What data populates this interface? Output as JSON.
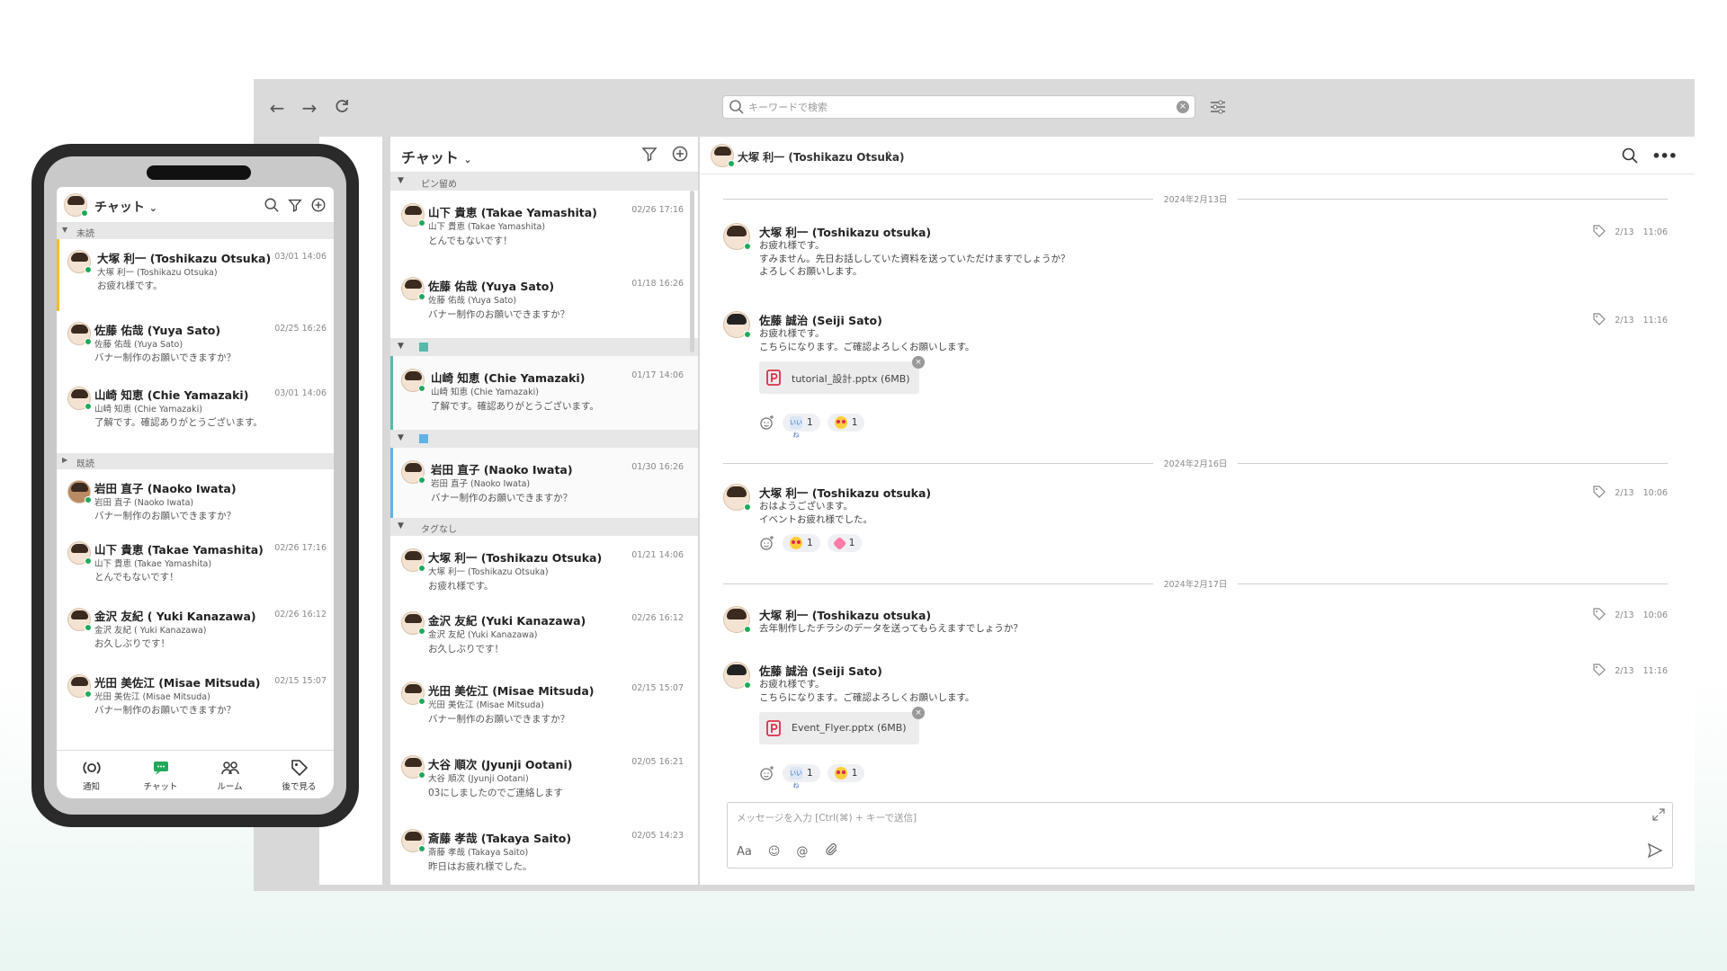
{
  "search": {
    "placeholder": "キーワードで検索"
  },
  "list": {
    "title": "チャット ",
    "groups": [
      {
        "label": "ピン留め",
        "items": [
          {
            "name": "山下 貴恵 (Takae Yamashita)",
            "sub": "山下 貴恵 (Takae Yamashita)",
            "msg": "とんでもないです！",
            "time": "02/26 17:16"
          },
          {
            "name": "佐藤 佑哉 (Yuya Sato)",
            "sub": "佐藤 佑哉 (Yuya Sato)",
            "msg": "バナー制作のお願いできますか？",
            "time": "01/18 16:26"
          }
        ]
      },
      {
        "label": "",
        "items": [
          {
            "name": "山崎 知恵 (Chie Yamazaki)",
            "sub": "山崎 知恵 (Chie Yamazaki)",
            "msg": "了解です。確認ありがとうございます。",
            "time": "01/17 14:06"
          }
        ]
      },
      {
        "label": "",
        "items": [
          {
            "name": "岩田 直子 (Naoko Iwata)",
            "sub": "岩田 直子 (Naoko Iwata)",
            "msg": "バナー制作のお願いできますか？",
            "time": "01/30 16:26"
          }
        ]
      },
      {
        "label": "タグなし",
        "items": [
          {
            "name": "大塚 利一 (Toshikazu Otsuka)",
            "sub": "大塚 利一 (Toshikazu Otsuka)",
            "msg": "お疲れ様です。",
            "time": "01/21 14:06"
          },
          {
            "name": "金沢 友紀 (Yuki Kanazawa)",
            "sub": "金沢 友紀 (Yuki Kanazawa)",
            "msg": "お久しぶりです！",
            "time": "02/26 16:12"
          },
          {
            "name": "光田 美佐江 (Misae Mitsuda)",
            "sub": "光田 美佐江 (Misae Mitsuda)",
            "msg": "バナー制作のお願いできますか？",
            "time": "02/15 15:07"
          },
          {
            "name": "大谷 順次 (Jyunji Ootani)",
            "sub": "大谷 順次 (Jyunji Ootani)",
            "msg": "03にしましたのでご連絡します",
            "time": "02/05 16:21"
          },
          {
            "name": "斎藤 孝哉 (Takaya Saito)",
            "sub": "斎藤 孝哉 (Takaya Saito)",
            "msg": "昨日はお疲れ様でした。",
            "time": "02/05 14:23"
          }
        ]
      }
    ]
  },
  "chat": {
    "header_name": "大塚 利一 (Toshikazu Otsuka)",
    "dates": [
      "2024年2月13日",
      "2024年2月16日",
      "2024年2月17日"
    ],
    "messages": [
      {
        "name": "大塚 利一 (Toshikazu otsuka)",
        "body": "お疲れ様です。\nすみません。先日お話ししていた資料を送っていただけますでしょうか？\nよろしくお願いします。",
        "date": "2/13",
        "time": "11:06"
      },
      {
        "name": "佐藤 誠治 (Seiji Sato)",
        "body": "お疲れ様です。\nこちらになります。ご確認よろしくお願いします。",
        "date": "2/13",
        "time": "11:16",
        "attachment": "tutorial_設計.pptx (6MB)"
      },
      {
        "name": "大塚 利一 (Toshikazu otsuka)",
        "body": "おはようございます。\nイベントお疲れ様でした。",
        "date": "2/13",
        "time": "10:06"
      },
      {
        "name": "大塚 利一 (Toshikazu otsuka)",
        "body": "去年制作したチラシのデータを送ってもらえますでしょうか？",
        "date": "2/13",
        "time": "10:06"
      },
      {
        "name": "佐藤 誠治 (Seiji Sato)",
        "body": "お疲れ様です。\nこちらになります。ご確認よろしくお願いします。",
        "date": "2/13",
        "time": "11:16",
        "attachment": "Event_Flyer.pptx (6MB)"
      }
    ],
    "reaction_count": "1",
    "composer_placeholder": "メッセージを入力 [Ctrl(⌘) + キーで送信]",
    "font_tool": "Aa"
  },
  "phone": {
    "title": "チャット",
    "unread_label": "未読",
    "read_label": "既読",
    "unread": [
      {
        "name": "大塚 利一 (Toshikazu Otsuka)",
        "sub": "大塚 利一 (Toshikazu Otsuka)",
        "msg": "お疲れ様です。",
        "time": "03/01 14:06"
      },
      {
        "name": "佐藤 佑哉 (Yuya Sato)",
        "sub": "佐藤 佑哉 (Yuya Sato)",
        "msg": "バナー制作のお願いできますか？",
        "time": "02/25 16:26"
      },
      {
        "name": "山崎 知恵 (Chie Yamazaki)",
        "sub": "山崎 知恵 (Chie Yamazaki)",
        "msg": "了解です。確認ありがとうございます。",
        "time": "03/01 14:06"
      }
    ],
    "read": [
      {
        "name": "岩田 直子 (Naoko Iwata)",
        "sub": "岩田 直子 (Naoko Iwata)",
        "msg": "バナー制作のお願いできますか？",
        "time": ""
      },
      {
        "name": "山下 貴恵 (Takae Yamashita)",
        "sub": "山下 貴恵 (Takae Yamashita)",
        "msg": "とんでもないです！",
        "time": "02/26 17:16"
      },
      {
        "name": "金沢 友紀 ( Yuki Kanazawa)",
        "sub": "金沢 友紀 ( Yuki Kanazawa)",
        "msg": "お久しぶりです！",
        "time": "02/26 16:12"
      },
      {
        "name": "光田 美佐江 (Misae Mitsuda)",
        "sub": "光田 美佐江 (Misae Mitsuda)",
        "msg": "バナー制作のお願いできますか？",
        "time": "02/15 15:07"
      }
    ],
    "tabs": [
      "通知",
      "チャット",
      "ルーム",
      "後で見る"
    ]
  },
  "colors": {
    "online": "#1eaa5a",
    "accent": "#55bba9",
    "unread_marker": "#f0c020",
    "pptx": "#d9304a"
  },
  "icons": [
    "back-icon",
    "forward-icon",
    "refresh-icon",
    "search-icon",
    "clear-icon",
    "settings-sliders-icon",
    "filter-icon",
    "add-icon",
    "chevron-down-icon",
    "tag-icon",
    "more-icon",
    "add-reaction-icon",
    "emoji-icon",
    "mention-icon",
    "attach-icon",
    "send-icon",
    "expand-icon",
    "pptx-file-icon",
    "bell-icon",
    "chat-icon",
    "room-icon"
  ]
}
